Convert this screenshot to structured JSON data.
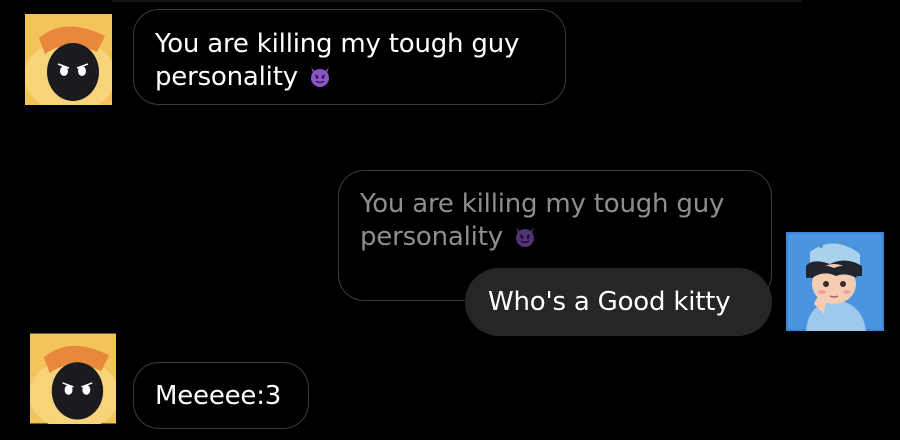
{
  "messages": [
    {
      "sender": "duck-avatar",
      "text_line1": "You are killing my tough guy",
      "text_line2": "personality",
      "emoji": "smiling-devil-emoji"
    },
    {
      "sender": "me",
      "quoted_line1": "You are killing my tough guy",
      "quoted_line2": "personality",
      "quoted_emoji": "smiling-devil-emoji",
      "text": "Who's a Good kitty"
    },
    {
      "sender": "duck-avatar",
      "text": "Meeeee:3"
    }
  ],
  "colors": {
    "background": "#000000",
    "bubble_border": "#3c3c3c",
    "reply_bubble": "#262626",
    "quoted_text": "#8e8e8e",
    "text": "#ffffff",
    "emoji_purple": "#8a55c8"
  },
  "icons": [
    "duck-hood-avatar-icon",
    "blue-boy-avatar-icon",
    "smiling-devil-emoji"
  ]
}
